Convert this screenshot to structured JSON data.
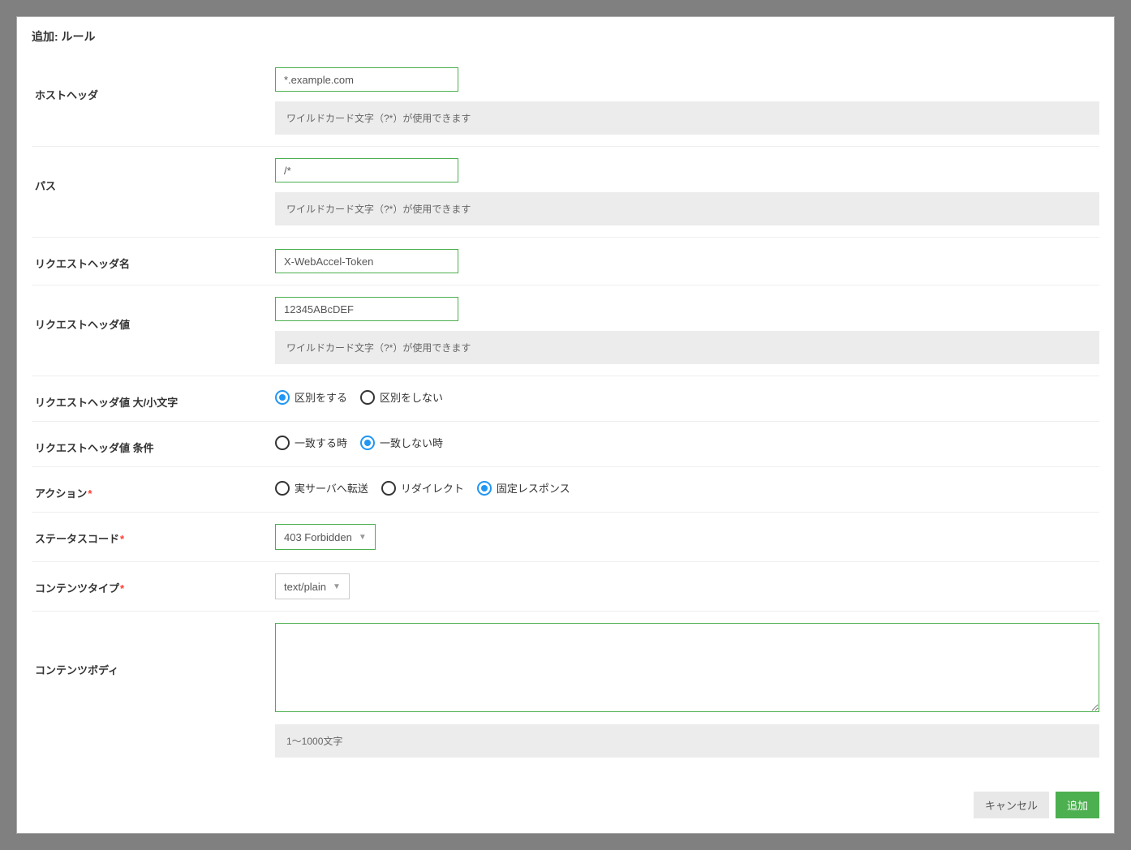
{
  "dialog": {
    "title": "追加: ルール"
  },
  "fields": {
    "hostHeader": {
      "label": "ホストヘッダ",
      "value": "*.example.com",
      "hint": "ワイルドカード文字（?*）が使用できます"
    },
    "path": {
      "label": "パス",
      "value": "/*",
      "hint": "ワイルドカード文字（?*）が使用できます"
    },
    "requestHeaderName": {
      "label": "リクエストヘッダ名",
      "value": "X-WebAccel-Token"
    },
    "requestHeaderValue": {
      "label": "リクエストヘッダ値",
      "value": "12345ABcDEF",
      "hint": "ワイルドカード文字（?*）が使用できます"
    },
    "caseSensitivity": {
      "label": "リクエストヘッダ値 大/小文字",
      "options": {
        "distinguish": "区別をする",
        "noDistinguish": "区別をしない"
      },
      "selected": "distinguish"
    },
    "condition": {
      "label": "リクエストヘッダ値 条件",
      "options": {
        "match": "一致する時",
        "noMatch": "一致しない時"
      },
      "selected": "noMatch"
    },
    "action": {
      "label": "アクション",
      "options": {
        "forward": "実サーバへ転送",
        "redirect": "リダイレクト",
        "fixed": "固定レスポンス"
      },
      "selected": "fixed"
    },
    "statusCode": {
      "label": "ステータスコード",
      "value": "403 Forbidden"
    },
    "contentType": {
      "label": "コンテンツタイプ",
      "value": "text/plain"
    },
    "contentBody": {
      "label": "コンテンツボディ",
      "value": "",
      "hint": "1〜1000文字"
    }
  },
  "buttons": {
    "cancel": "キャンセル",
    "submit": "追加"
  }
}
